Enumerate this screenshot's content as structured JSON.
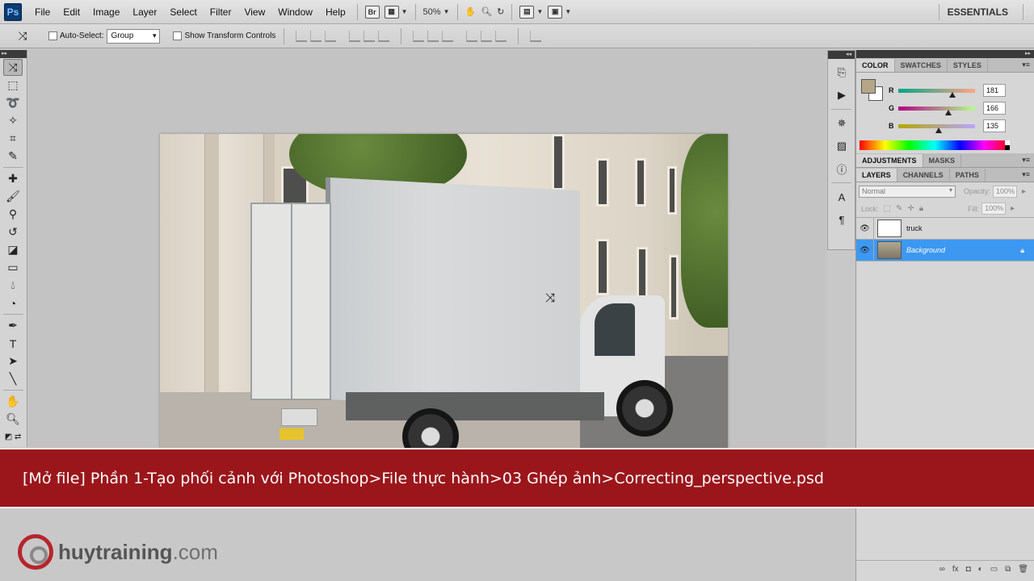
{
  "app": {
    "logo": "Ps",
    "workspace": "ESSENTIALS"
  },
  "menu": [
    "File",
    "Edit",
    "Image",
    "Layer",
    "Select",
    "Filter",
    "View",
    "Window",
    "Help"
  ],
  "menubar": {
    "bridge_label": "Br",
    "zoom": "50%"
  },
  "options": {
    "auto_select_label": "Auto-Select:",
    "auto_select_value": "Group",
    "show_transform_label": "Show Transform Controls"
  },
  "color_panel": {
    "tabs": [
      "COLOR",
      "SWATCHES",
      "STYLES"
    ],
    "foreground": "#b5a687",
    "background": "#ffffff",
    "channels": [
      {
        "name": "R",
        "value": "181",
        "level": 0.71
      },
      {
        "name": "G",
        "value": "166",
        "level": 0.65
      },
      {
        "name": "B",
        "value": "135",
        "level": 0.53
      }
    ]
  },
  "adjustments_panel": {
    "tabs": [
      "ADJUSTMENTS",
      "MASKS"
    ]
  },
  "layers_panel": {
    "tabs": [
      "LAYERS",
      "CHANNELS",
      "PATHS"
    ],
    "blend_mode": "Normal",
    "opacity_label": "Opacity:",
    "opacity_value": "100%",
    "lock_label": "Lock:",
    "fill_label": "Fill:",
    "fill_value": "100%",
    "layers": [
      {
        "name": "truck",
        "selected": false
      },
      {
        "name": "Background",
        "selected": true
      }
    ]
  },
  "banner": {
    "text": "[Mở file] Phần 1-Tạo phối cảnh với Photoshop>File thực hành>03 Ghép ảnh>Correcting_perspective.psd"
  },
  "brand": {
    "name": "huytraining",
    "domain": ".com",
    "accent": "#b6252c"
  },
  "colors": {
    "selection": "#3d98f1",
    "banner": "#9b161b"
  }
}
